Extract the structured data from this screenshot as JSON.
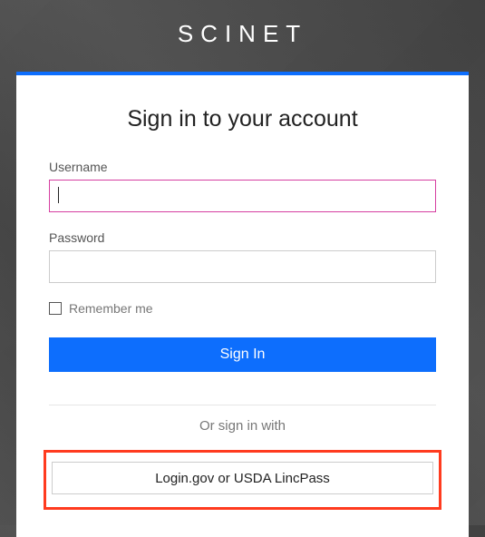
{
  "brand": "SCINET",
  "card": {
    "title": "Sign in to your account",
    "username_label": "Username",
    "username_value": "",
    "password_label": "Password",
    "password_value": "",
    "remember_label": "Remember me",
    "signin_label": "Sign In",
    "divider_text": "Or sign in with",
    "alt_signin_label": "Login.gov or USDA LincPass"
  },
  "colors": {
    "accent": "#0d6efd",
    "focus_border": "#d63fa1",
    "highlight_box": "#ff3b1f"
  }
}
